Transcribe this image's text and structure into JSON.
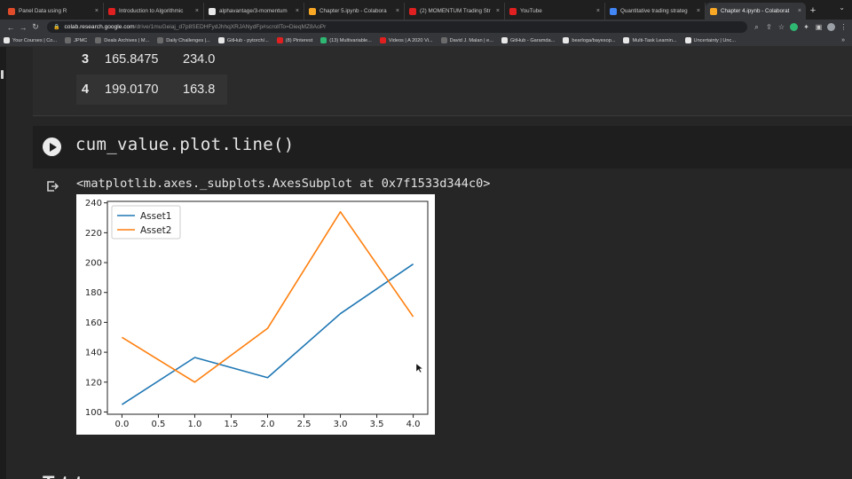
{
  "browser": {
    "tabs": [
      {
        "title": "Panel Data using R",
        "favicon_color": "#e04b2a"
      },
      {
        "title": "Introduction to Algorithmic",
        "favicon_color": "#e02020"
      },
      {
        "title": "alphavantage/3-momentum",
        "favicon_color": "#e8e8e8"
      },
      {
        "title": "Chapter 5.ipynb - Colabora",
        "favicon_color": "#f9a825"
      },
      {
        "title": "(2) MOMENTUM Trading Str",
        "favicon_color": "#e02020"
      },
      {
        "title": "YouTube",
        "favicon_color": "#e02020"
      },
      {
        "title": "Quantitative trading strateg",
        "favicon_color": "#4285f4"
      },
      {
        "title": "Chapter 4.ipynb - Colaborat",
        "favicon_color": "#f9a825",
        "active": true
      }
    ],
    "url_host": "colab.research.google.com",
    "url_path": "/drive/1muGeiaj_d7p8SEDHFydJhhqXRJANydFp#scrollTo=DieqMZ8AoPr",
    "bookmarks": [
      {
        "label": "Your Courses | Co...",
        "color": "#e8e8e8"
      },
      {
        "label": "JPMC",
        "color": "#6b6b6b"
      },
      {
        "label": "Deals Archives | M...",
        "color": "#6b6b6b"
      },
      {
        "label": "Daily Challenges |...",
        "color": "#6b6b6b"
      },
      {
        "label": "GitHub - pytorch/...",
        "color": "#e8e8e8"
      },
      {
        "label": "(8) Pinterest",
        "color": "#e02020"
      },
      {
        "label": "(13) Multivariable...",
        "color": "#2eb872"
      },
      {
        "label": "Videos | A 2020 Vi...",
        "color": "#e02020"
      },
      {
        "label": "David J. Malan | e...",
        "color": "#6b6b6b"
      },
      {
        "label": "GitHub - Garamda...",
        "color": "#e8e8e8"
      },
      {
        "label": "bearloga/bayesop...",
        "color": "#e8e8e8"
      },
      {
        "label": "Multi-Task Learnin...",
        "color": "#e8e8e8"
      },
      {
        "label": "Uncertainty | Unc...",
        "color": "#e8e8e8"
      }
    ]
  },
  "notebook": {
    "table_rows": [
      {
        "index": "3",
        "asset1": "165.8475",
        "asset2": "234.0"
      },
      {
        "index": "4",
        "asset1": "199.0170",
        "asset2": "163.8"
      }
    ],
    "code": "cum_value.plot.line()",
    "output_repr": "<matplotlib.axes._subplots.AxesSubplot at 0x7f1533d344c0>",
    "next_cell_text": "T         t    t"
  },
  "chart_data": {
    "type": "line",
    "x": [
      0.0,
      1.0,
      2.0,
      3.0,
      4.0
    ],
    "series": [
      {
        "name": "Asset1",
        "values": [
          105.0,
          136.5,
          123.0,
          165.8475,
          199.017
        ],
        "color": "#1f77b4"
      },
      {
        "name": "Asset2",
        "values": [
          150.0,
          120.0,
          156.0,
          234.0,
          163.8
        ],
        "color": "#ff7f0e"
      }
    ],
    "xlim": [
      -0.2,
      4.2
    ],
    "ylim": [
      98.5,
      241.0
    ],
    "xticks": [
      "0.0",
      "0.5",
      "1.0",
      "1.5",
      "2.0",
      "2.5",
      "3.0",
      "3.5",
      "4.0"
    ],
    "yticks": [
      "100",
      "120",
      "140",
      "160",
      "180",
      "200",
      "220",
      "240"
    ],
    "legend": "upper-left",
    "grid": false
  }
}
